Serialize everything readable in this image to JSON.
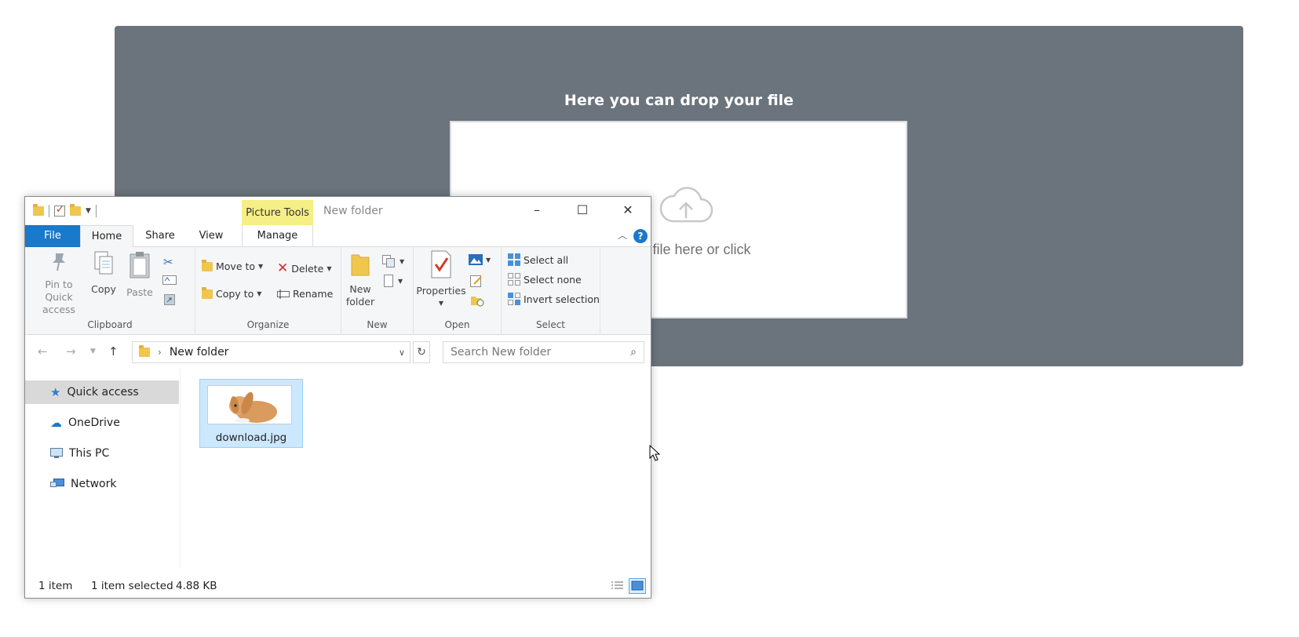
{
  "dropzone": {
    "title": "Here you can drop your file",
    "text": "Drop a file here or click",
    "panel_color": "#6b747c"
  },
  "explorer": {
    "window_title": "New folder",
    "context_tab": "Picture Tools",
    "tabs": {
      "file": "File",
      "home": "Home",
      "share": "Share",
      "view": "View",
      "manage": "Manage"
    },
    "help": "?",
    "ribbon": {
      "clipboard": {
        "label": "Clipboard",
        "pin": "Pin to Quick access",
        "copy": "Copy",
        "paste": "Paste"
      },
      "organize": {
        "label": "Organize",
        "move_to": "Move to",
        "copy_to": "Copy to",
        "delete": "Delete",
        "rename": "Rename"
      },
      "new": {
        "label": "New",
        "new_folder": "New folder"
      },
      "open": {
        "label": "Open",
        "properties": "Properties"
      },
      "select": {
        "label": "Select",
        "select_all": "Select all",
        "select_none": "Select none",
        "invert": "Invert selection"
      }
    },
    "address": {
      "path": "New folder"
    },
    "search": {
      "placeholder": "Search New folder"
    },
    "nav": [
      {
        "label": "Quick access",
        "icon": "star-icon"
      },
      {
        "label": "OneDrive",
        "icon": "cloud-icon"
      },
      {
        "label": "This PC",
        "icon": "computer-icon"
      },
      {
        "label": "Network",
        "icon": "network-icon"
      }
    ],
    "files": [
      {
        "name": "download.jpg"
      }
    ],
    "status": {
      "count": "1 item",
      "selected": "1 item selected",
      "size": "4.88 KB"
    },
    "colors": {
      "file_tab": "#1979ca",
      "picture_tools": "#f5ef85",
      "selection": "#cce8ff"
    }
  }
}
